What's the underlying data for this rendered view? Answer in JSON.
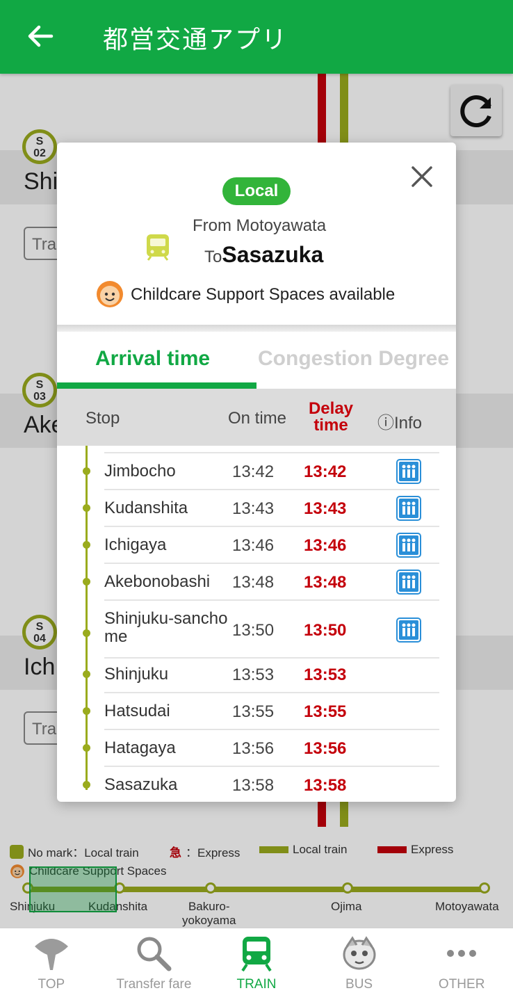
{
  "app": {
    "title": "都営交通アプリ"
  },
  "background": {
    "stations": [
      {
        "code_line": "S",
        "code_num": "02",
        "name_partial": "Shi",
        "button_partial": "Tra"
      },
      {
        "code_line": "S",
        "code_num": "03",
        "name_partial": "Ake"
      },
      {
        "code_line": "S",
        "code_num": "04",
        "name_partial": "Ich",
        "button_partial": "Tra"
      }
    ]
  },
  "legend": {
    "no_mark": "No mark：Local train",
    "express_mark": "急",
    "express_label": "：Express",
    "local_line": "Local train",
    "express_line": "Express",
    "childcare": "Childcare Support Spaces",
    "route_stations": [
      "Shinjuku",
      "Kudanshita",
      "Bakuro-\nyokoyama",
      "Ojima",
      "Motoyawata"
    ]
  },
  "modal": {
    "type_badge": "Local",
    "from": "From Motoyawata",
    "to_prefix": "To",
    "to_station": "Sasazuka",
    "childcare_note": "Childcare Support Spaces available",
    "tabs": [
      {
        "label": "Arrival time",
        "active": true
      },
      {
        "label": "Congestion Degree",
        "active": false
      }
    ],
    "columns": {
      "stop": "Stop",
      "on_time": "On time",
      "delay_time": "Delay time",
      "info": "ⓘInfo"
    },
    "rows": [
      {
        "stop": "Jimbocho",
        "on_time": "13:42",
        "delay_time": "13:42",
        "congestion_icon": true
      },
      {
        "stop": "Kudanshita",
        "on_time": "13:43",
        "delay_time": "13:43",
        "congestion_icon": true
      },
      {
        "stop": "Ichigaya",
        "on_time": "13:46",
        "delay_time": "13:46",
        "congestion_icon": true
      },
      {
        "stop": "Akebonobashi",
        "on_time": "13:48",
        "delay_time": "13:48",
        "congestion_icon": true
      },
      {
        "stop": "Shinjuku-sanchome",
        "on_time": "13:50",
        "delay_time": "13:50",
        "congestion_icon": true
      },
      {
        "stop": "Shinjuku",
        "on_time": "13:53",
        "delay_time": "13:53",
        "congestion_icon": false
      },
      {
        "stop": "Hatsudai",
        "on_time": "13:55",
        "delay_time": "13:55",
        "congestion_icon": false
      },
      {
        "stop": "Hatagaya",
        "on_time": "13:56",
        "delay_time": "13:56",
        "congestion_icon": false
      },
      {
        "stop": "Sasazuka",
        "on_time": "13:58",
        "delay_time": "13:58",
        "congestion_icon": false
      }
    ]
  },
  "bottom_nav": [
    {
      "label": "TOP",
      "icon": "tree-icon",
      "active": false
    },
    {
      "label": "Transfer fare",
      "icon": "search-icon",
      "active": false
    },
    {
      "label": "TRAIN",
      "icon": "train-icon",
      "active": true
    },
    {
      "label": "BUS",
      "icon": "bus-mascot-icon",
      "active": false
    },
    {
      "label": "OTHER",
      "icon": "more-icon",
      "active": false
    }
  ],
  "colors": {
    "brand_green": "#11a844",
    "line_color_shinjuku": "#9aab1d",
    "express_red": "#c4000b",
    "congestion_blue": "#2a8fd8"
  }
}
